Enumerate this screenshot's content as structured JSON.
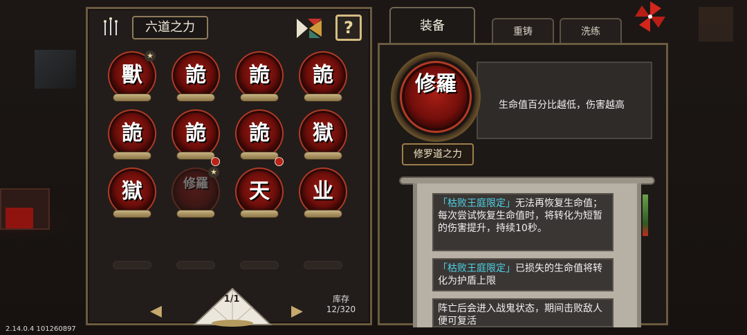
{
  "left_panel": {
    "title": "六道之力",
    "stock_label": "库存",
    "stock_count": "12/320",
    "page_indicator": "1/1",
    "orbs": [
      {
        "glyph": "獸",
        "starred": true,
        "locked": false,
        "dim": false
      },
      {
        "glyph": "詭",
        "starred": false,
        "locked": false,
        "dim": false
      },
      {
        "glyph": "詭",
        "starred": false,
        "locked": false,
        "dim": false
      },
      {
        "glyph": "詭",
        "starred": false,
        "locked": false,
        "dim": false
      },
      {
        "glyph": "詭",
        "starred": false,
        "locked": false,
        "dim": false
      },
      {
        "glyph": "詭",
        "starred": false,
        "locked": true,
        "dim": false
      },
      {
        "glyph": "詭",
        "starred": false,
        "locked": true,
        "dim": false
      },
      {
        "glyph": "獄",
        "starred": false,
        "locked": false,
        "dim": false
      },
      {
        "glyph": "獄",
        "starred": false,
        "locked": false,
        "dim": false
      },
      {
        "glyph": "修羅",
        "starred": true,
        "locked": false,
        "dim": true
      },
      {
        "glyph": "天",
        "starred": false,
        "locked": false,
        "dim": false
      },
      {
        "glyph": "业",
        "starred": false,
        "locked": false,
        "dim": false
      }
    ]
  },
  "tabs": {
    "equip": "装备",
    "reforge": "重铸",
    "refine": "洗练"
  },
  "detail": {
    "glyph": "修羅",
    "name": "修罗道之力",
    "description": "生命值百分比越低，伤害越高",
    "entries": [
      {
        "tag": "「枯败王庭限定」",
        "text": "无法再恢复生命值；每次尝试恢复生命值时，将转化为短暂的伤害提升，持续10秒。"
      },
      {
        "tag": "「枯败王庭限定」",
        "text": "已损失的生命值将转化为护盾上限"
      },
      {
        "tag": "",
        "text": "阵亡后会进入战鬼状态，期间击败敌人便可复活"
      }
    ]
  },
  "version": "2.14.0.4 101260897",
  "colors": {
    "accent_gold": "#c6aa6d",
    "orb_red": "#9a1c14",
    "tag_cyan": "#4fd2e6"
  }
}
